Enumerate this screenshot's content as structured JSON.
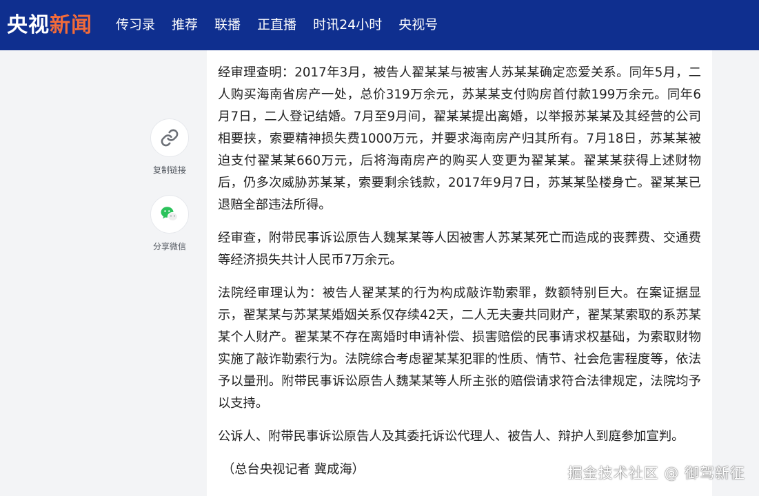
{
  "header": {
    "logo_part1": "央视",
    "logo_part2": "新闻",
    "nav": [
      "传习录",
      "推荐",
      "联播",
      "正直播",
      "时讯24小时",
      "央视号"
    ]
  },
  "sidebar": {
    "copy_link_label": "复制链接",
    "share_wechat_label": "分享微信"
  },
  "article": {
    "paragraphs": [
      "经审理查明：2017年3月，被告人翟某某与被害人苏某某确定恋爱关系。同年5月，二人购买海南省房产一处，总价319万余元，苏某某支付购房首付款199万余元。同年6月7日，二人登记结婚。7月至9月间，翟某某提出离婚，以举报苏某某及其经营的公司相要挟，索要精神损失费1000万元，并要求海南房产归其所有。7月18日，苏某某被迫支付翟某某660万元，后将海南房产的购买人变更为翟某某。翟某某获得上述财物后，仍多次威胁苏某某，索要剩余钱款，2017年9月7日，苏某某坠楼身亡。翟某某已退赔全部违法所得。",
      "经审查，附带民事诉讼原告人魏某某等人因被害人苏某某死亡而造成的丧葬费、交通费等经济损失共计人民币7万余元。",
      "法院经审理认为：被告人翟某某的行为构成敲诈勒索罪，数额特别巨大。在案证据显示，翟某某与苏某某婚姻关系仅存续42天，二人无夫妻共同财产，翟某某索取的系苏某某个人财产。翟某某不存在离婚时申请补偿、损害赔偿的民事请求权基础，为索取财物实施了敲诈勒索行为。法院综合考虑翟某某犯罪的性质、情节、社会危害程度等，依法予以量刑。附带民事诉讼原告人魏某某等人所主张的赔偿请求符合法律规定，法院均予以支持。",
      "公诉人、附带民事诉讼原告人及其委托诉讼代理人、被告人、辩护人到庭参加宣判。"
    ],
    "credit": "（总台央视记者 冀成海）"
  },
  "watermark": "掘金技术社区 @ 御驾新征",
  "colors": {
    "header_bg": "#0f2f8f",
    "logo_accent": "#f26b3a",
    "wechat_green": "#2bc25b"
  },
  "icons": {
    "copy_link": "link-icon",
    "share_wechat": "wechat-icon"
  }
}
